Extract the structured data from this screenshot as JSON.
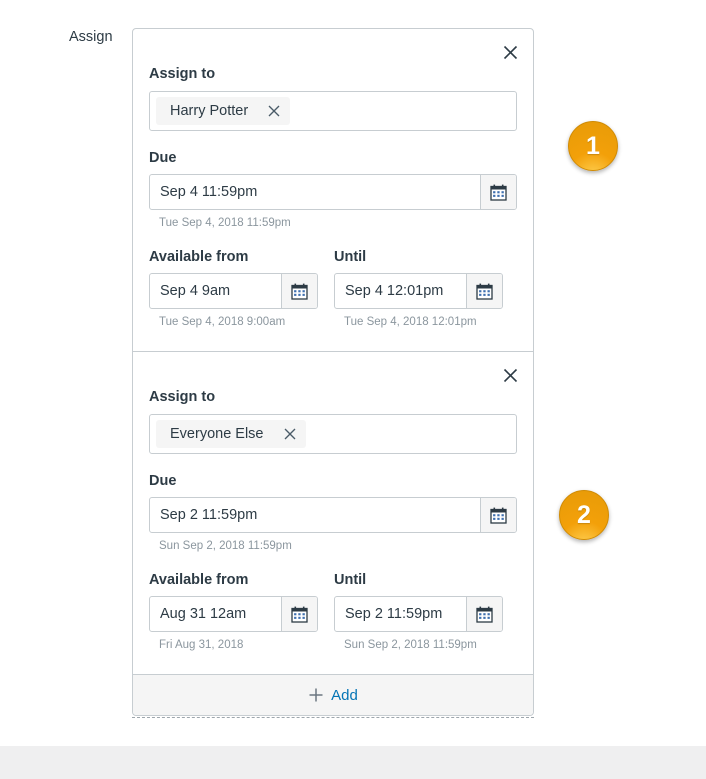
{
  "form": {
    "assign_label": "Assign",
    "add_label": "Add",
    "add_icon": "plus-icon"
  },
  "icons": {
    "close": "close-icon",
    "calendar": "calendar-icon",
    "token_remove": "close-icon",
    "plus": "plus-icon"
  },
  "labels": {
    "assign_to": "Assign to",
    "due": "Due",
    "available_from": "Available from",
    "until": "Until"
  },
  "colors": {
    "link": "#0374B5",
    "text": "#2D3B45",
    "help_text": "#8B969E",
    "border": "#C7CDD1",
    "badge": "#F3A009",
    "panel_bg": "#F5F5F5"
  },
  "overrides": [
    {
      "badge": "1",
      "assignees": [
        {
          "name": "Harry Potter"
        }
      ],
      "due": {
        "value": "Sep 4 11:59pm",
        "placeholder": "",
        "help": "Tue Sep 4, 2018 11:59pm"
      },
      "available_from": {
        "value": "Sep 4 9am",
        "placeholder": "",
        "help": "Tue Sep 4, 2018 9:00am"
      },
      "until": {
        "value": "Sep 4 12:01pm",
        "placeholder": "",
        "help": "Tue Sep 4, 2018 12:01pm"
      }
    },
    {
      "badge": "2",
      "assignees": [
        {
          "name": "Everyone Else"
        }
      ],
      "due": {
        "value": "Sep 2 11:59pm",
        "placeholder": "",
        "help": "Sun Sep 2, 2018 11:59pm"
      },
      "available_from": {
        "value": "Aug 31 12am",
        "placeholder": "",
        "help": "Fri Aug 31, 2018"
      },
      "until": {
        "value": "Sep 2 11:59pm",
        "placeholder": "",
        "help": "Sun Sep 2, 2018 11:59pm"
      }
    }
  ]
}
